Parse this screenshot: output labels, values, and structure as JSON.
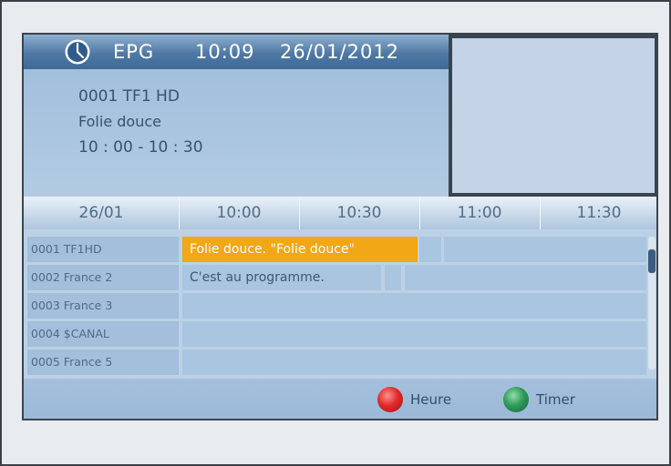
{
  "header": {
    "title": "EPG",
    "time": "10:09",
    "date": "26/01/2012",
    "icon": "clock-icon"
  },
  "info": {
    "channel": "0001  TF1 HD",
    "program": "Folie douce",
    "timeslot": "10 : 00  -  10 : 30"
  },
  "grid": {
    "date": "26/01",
    "times": [
      "10:00",
      "10:30",
      "11:00",
      "11:30"
    ],
    "channels": [
      {
        "name": "0001 TF1HD",
        "programs": [
          "Folie douce.  \"Folie douce\""
        ],
        "selected": true
      },
      {
        "name": "0002 France 2",
        "programs": [
          "C'est au programme."
        ],
        "selected": false
      },
      {
        "name": "0003 France 3",
        "programs": [],
        "selected": false
      },
      {
        "name": "0004 $CANAL",
        "programs": [],
        "selected": false
      },
      {
        "name": "0005 France 5",
        "programs": [],
        "selected": false
      }
    ]
  },
  "footer": {
    "red_label": "Heure",
    "green_label": "Timer"
  },
  "colors": {
    "selected": "#f2a716",
    "red_key": "#d9252b",
    "green_key": "#2e8b52"
  }
}
